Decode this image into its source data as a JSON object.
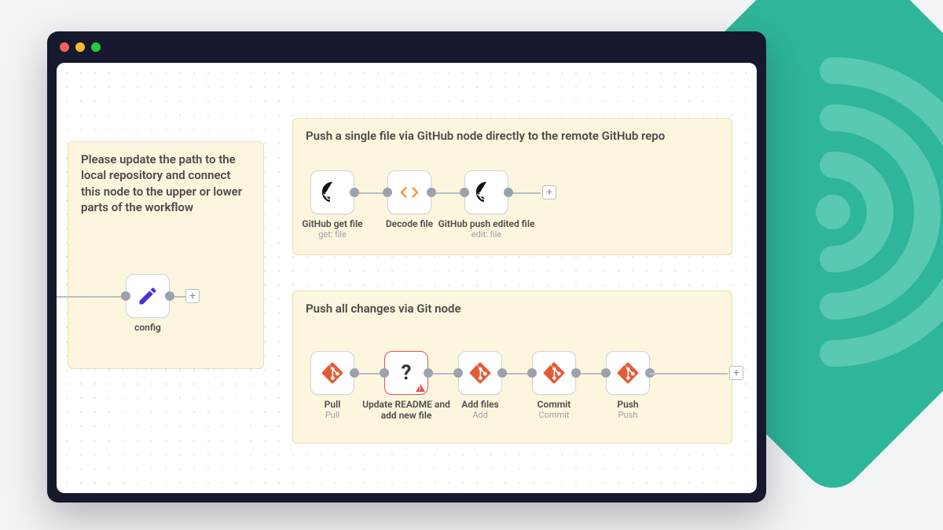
{
  "colors": {
    "accent_teal": "#2eb59a",
    "git_orange": "#e45b34",
    "code_orange": "#f5952b",
    "edit_purple": "#4834d4",
    "error_red": "#e6534f"
  },
  "window": {
    "traffic_lights": [
      "close",
      "minimize",
      "zoom"
    ]
  },
  "left_sticky": {
    "note": "Please update the path to the local repository and connect this node to the upper or lower parts of the workflow",
    "node": {
      "name": "config",
      "sub": ""
    }
  },
  "group_top": {
    "title": "Push a single file via GitHub node directly to the remote GitHub repo",
    "nodes": [
      {
        "name": "GitHub get file",
        "sub": "get: file",
        "icon": "github"
      },
      {
        "name": "Decode file",
        "sub": "",
        "icon": "code"
      },
      {
        "name": "GitHub push edited file",
        "sub": "edit: file",
        "icon": "github"
      }
    ]
  },
  "group_bottom": {
    "title": "Push all changes via Git node",
    "nodes": [
      {
        "name": "Pull",
        "sub": "Pull",
        "icon": "git"
      },
      {
        "name": "Update README and add new file",
        "sub": "",
        "icon": "question",
        "error": true
      },
      {
        "name": "Add files",
        "sub": "Add",
        "icon": "git"
      },
      {
        "name": "Commit",
        "sub": "Commit",
        "icon": "git"
      },
      {
        "name": "Push",
        "sub": "Push",
        "icon": "git"
      }
    ]
  }
}
